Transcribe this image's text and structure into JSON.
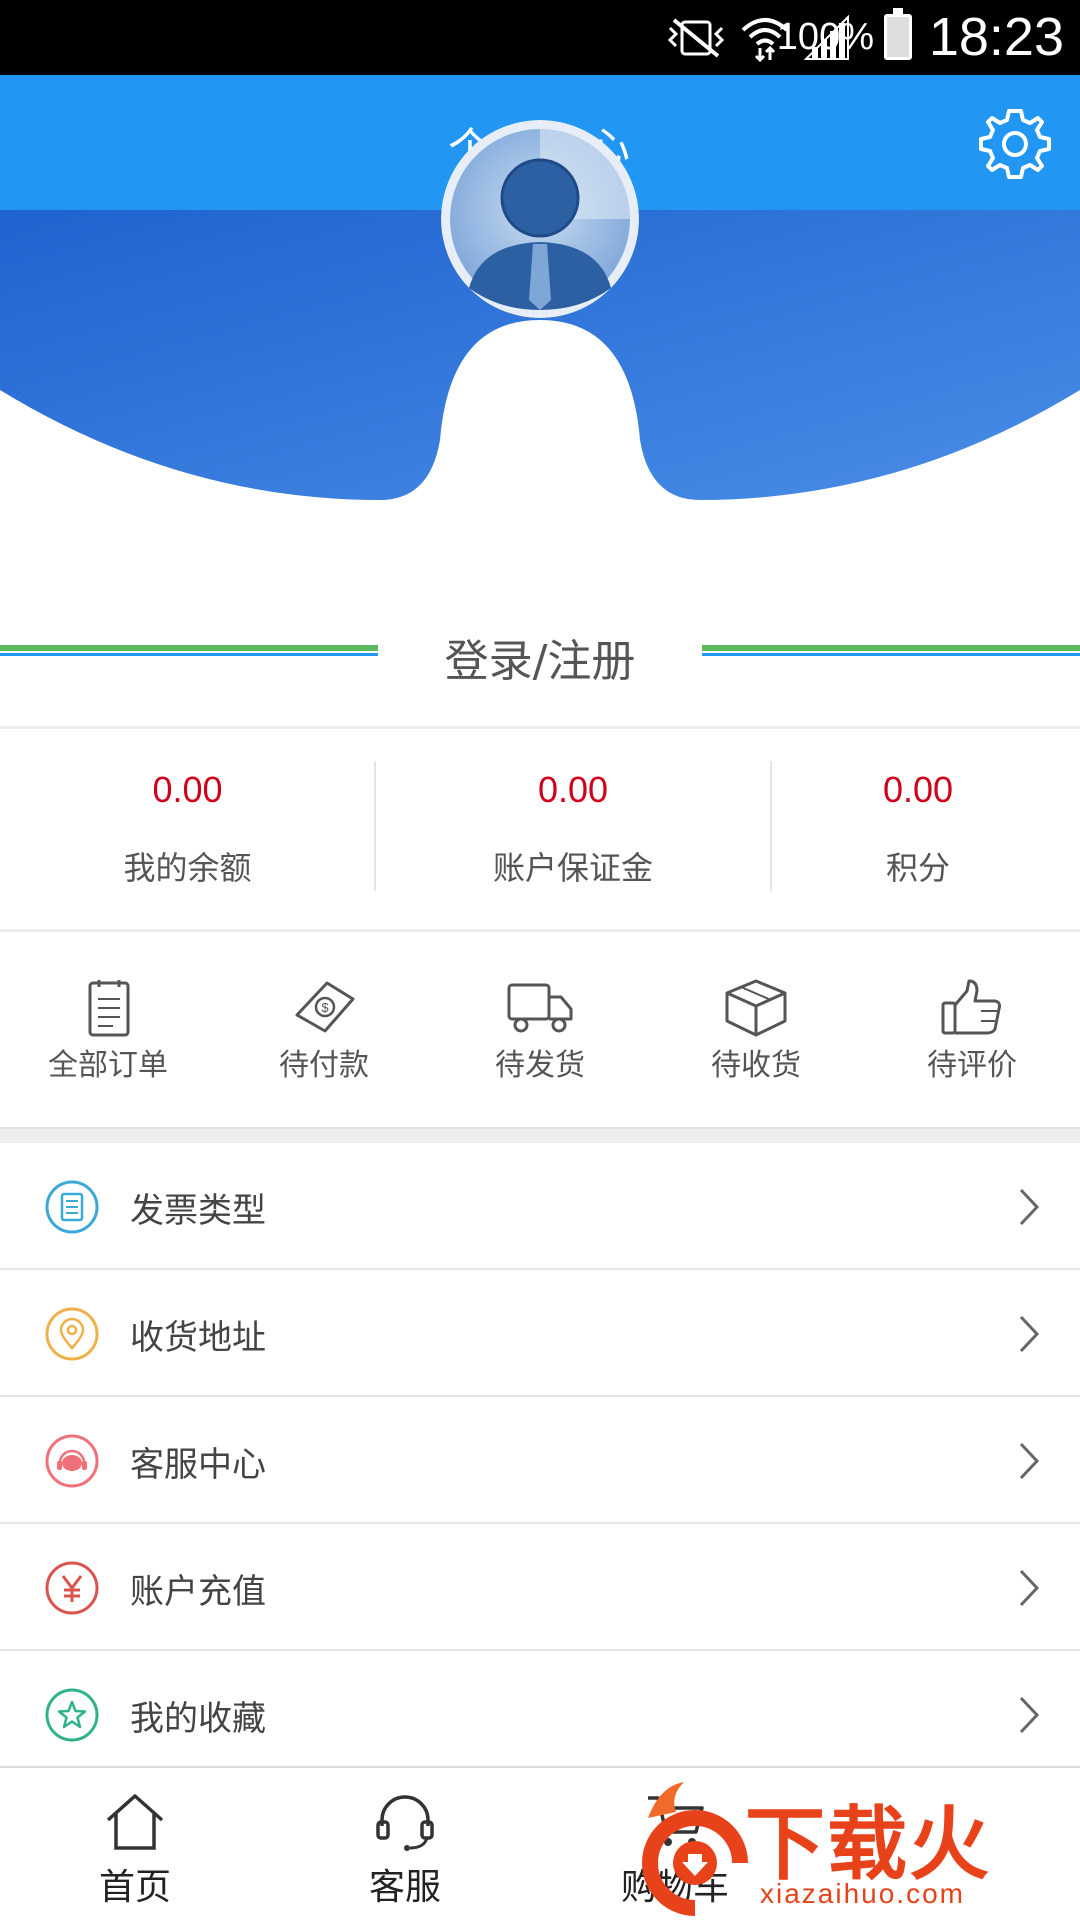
{
  "status_bar": {
    "battery": "100%",
    "time": "18:23"
  },
  "header": {
    "title": "个人中心",
    "settings_icon": "gear-icon"
  },
  "login": {
    "label": "登录/注册"
  },
  "stats": [
    {
      "value": "0.00",
      "label": "我的余额"
    },
    {
      "value": "0.00",
      "label": "账户保证金"
    },
    {
      "value": "0.00",
      "label": "积分"
    }
  ],
  "orders": [
    {
      "label": "全部订单",
      "icon": "clipboard-icon"
    },
    {
      "label": "待付款",
      "icon": "money-bill-icon"
    },
    {
      "label": "待发货",
      "icon": "truck-icon"
    },
    {
      "label": "待收货",
      "icon": "package-icon"
    },
    {
      "label": "待评价",
      "icon": "thumbs-up-icon"
    }
  ],
  "menu": [
    {
      "label": "发票类型",
      "icon": "invoice-icon",
      "color": "#3aa8d8"
    },
    {
      "label": "收货地址",
      "icon": "location-pin-icon",
      "color": "#f0b04a"
    },
    {
      "label": "客服中心",
      "icon": "customer-service-icon",
      "color": "#f0707a"
    },
    {
      "label": "账户充值",
      "icon": "yuan-icon",
      "color": "#d9534f"
    },
    {
      "label": "我的收藏",
      "icon": "star-icon",
      "color": "#2fb38a"
    }
  ],
  "tabbar": [
    {
      "label": "首页",
      "icon": "home-icon"
    },
    {
      "label": "客服",
      "icon": "headset-icon"
    },
    {
      "label": "购物车",
      "icon": "cart-icon"
    }
  ],
  "watermark": {
    "brand": "下载火",
    "url": "xiazaihuo.com"
  },
  "colors": {
    "primary": "#2196f3",
    "value_red": "#d0021b",
    "accent_green": "#5cb85c"
  }
}
